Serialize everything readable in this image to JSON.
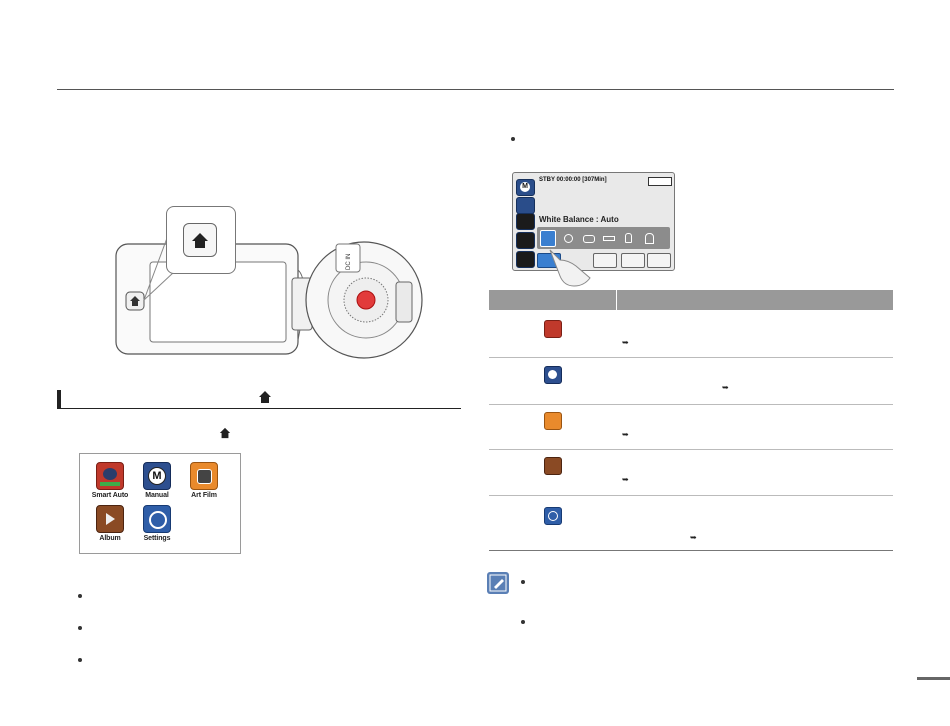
{
  "lcd": {
    "status": "STBY 00:00:00 [307Min]",
    "white_balance": "White Balance : Auto",
    "mode_badge": "M"
  },
  "menu": {
    "items": [
      {
        "label": "Smart Auto"
      },
      {
        "label": "Manual"
      },
      {
        "label": "Art Film"
      },
      {
        "label": "Album"
      },
      {
        "label": "Settings"
      }
    ]
  },
  "camera": {
    "label": "DC IN"
  },
  "colors": {
    "table_header": "#999999",
    "record_red": "#e23b3b",
    "lcd_blue": "#2a4d8a",
    "highlight_blue": "#3a7fd0"
  }
}
